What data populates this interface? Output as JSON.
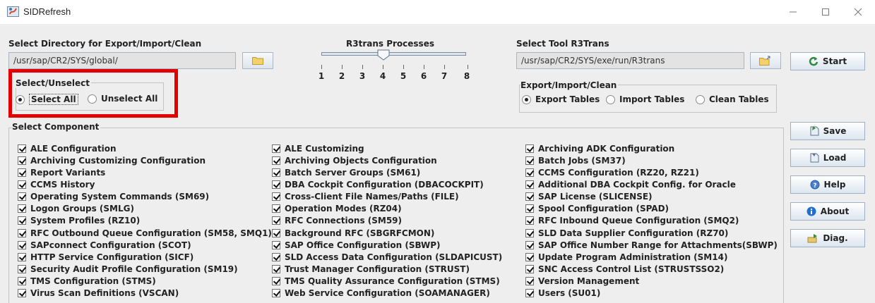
{
  "window": {
    "title": "SIDRefresh"
  },
  "export_dir": {
    "label": "Select Directory for Export/Import/Clean",
    "value": "/usr/sap/CR2/SYS/global/"
  },
  "r3trans_processes": {
    "label": "R3trans Processes",
    "ticks": [
      "1",
      "2",
      "3",
      "4",
      "5",
      "6",
      "7",
      "8"
    ],
    "value": 4
  },
  "tool": {
    "label": "Select Tool R3Trans",
    "value": "/usr/sap/CR2/SYS/exe/run/R3trans"
  },
  "select_unselect": {
    "title": "Select/Unselect",
    "options": [
      "Select All",
      "Unselect All"
    ],
    "selected": "Select All"
  },
  "mode": {
    "title": "Export/Import/Clean",
    "options": [
      "Export Tables",
      "Import Tables",
      "Clean Tables"
    ],
    "selected": "Export Tables"
  },
  "buttons": {
    "start": "Start",
    "save": "Save",
    "load": "Load",
    "help": "Help",
    "about": "About",
    "diag": "Diag."
  },
  "components": {
    "title": "Select Component",
    "columns": [
      [
        "ALE Configuration",
        "Archiving Customizing Configuration",
        "Report Variants",
        "CCMS History",
        "Operating System Commands (SM69)",
        "Logon Groups (SMLG)",
        "System Profiles (RZ10)",
        "RFC Outbound Queue Configuration (SM58, SMQ1)",
        "SAPconnect Configuration (SCOT)",
        "HTTP Service Configuration (SICF)",
        "Security Audit Profile Configuration (SM19)",
        "TMS Configuration (STMS)",
        "Virus Scan Definitions (VSCAN)"
      ],
      [
        "ALE Customizing",
        "Archiving Objects Configuration",
        "Batch Server Groups (SM61)",
        "DBA Cockpit Configuration (DBACOCKPIT)",
        "Cross-Client File Names/Paths (FILE)",
        "Operation Modes (RZ04)",
        "RFC Connections (SM59)",
        "Background RFC (SBGRFCMON)",
        "SAP Office Configuration (SBWP)",
        "SLD Access Data Configuration (SLDAPICUST)",
        "Trust Manager Configuration (STRUST)",
        "TMS Quality Assurance Configuration (STMS)",
        "Web Service Configuration (SOAMANAGER)"
      ],
      [
        "Archiving ADK Configuration",
        "Batch Jobs (SM37)",
        "CCMS Configuration (RZ20, RZ21)",
        "Additional DBA Cockpit Config. for Oracle",
        "SAP License (SLICENSE)",
        "Spool Configuration (SPAD)",
        "RFC Inbound Queue Configuration (SMQ2)",
        "SLD Data Supplier Configuration (RZ70)",
        "SAP Office Number Range for Attachments(SBWP)",
        "Update Program Administration (SM14)",
        "SNC Access Control List (STRUSTSSO2)",
        "Version Management",
        "Users (SU01)"
      ]
    ]
  },
  "colors": {
    "highlight": "#e50000",
    "panel_bg": "#eeeeee",
    "field_bg": "#e3e3e3"
  }
}
